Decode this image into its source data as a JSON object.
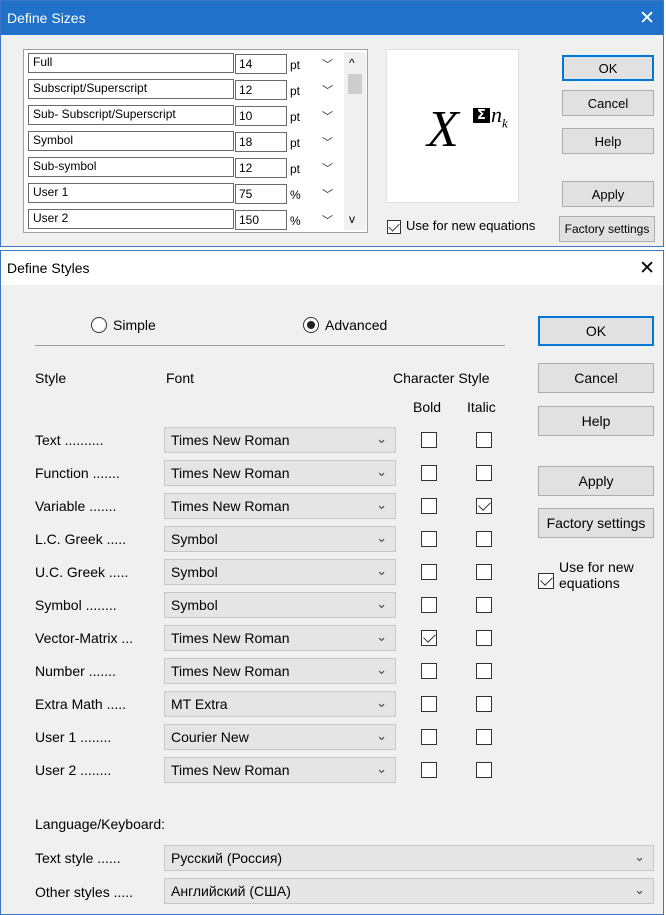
{
  "define_sizes": {
    "title": "Define Sizes",
    "rows": [
      {
        "label": "Full",
        "value": "14",
        "unit": "pt"
      },
      {
        "label": "Subscript/Superscript",
        "value": "12",
        "unit": "pt"
      },
      {
        "label": "Sub- Subscript/Superscript",
        "value": "10",
        "unit": "pt"
      },
      {
        "label": "Symbol",
        "value": "18",
        "unit": "pt"
      },
      {
        "label": "Sub-symbol",
        "value": "12",
        "unit": "pt"
      },
      {
        "label": "User 1",
        "value": "75",
        "unit": "%"
      },
      {
        "label": "User 2",
        "value": "150",
        "unit": "%"
      }
    ],
    "use_for_new_label": "Use for new equations",
    "use_for_new_checked": true,
    "buttons": {
      "ok": "OK",
      "cancel": "Cancel",
      "help": "Help",
      "apply": "Apply",
      "factory": "Factory settings"
    }
  },
  "define_styles": {
    "title": "Define Styles",
    "mode_simple": "Simple",
    "mode_advanced": "Advanced",
    "selected_mode": "Advanced",
    "headers": {
      "style": "Style",
      "font": "Font",
      "char_style": "Character Style",
      "bold": "Bold",
      "italic": "Italic"
    },
    "rows": [
      {
        "label": "Text ..........",
        "font": "Times New Roman",
        "bold": false,
        "italic": false
      },
      {
        "label": "Function .......",
        "font": "Times New Roman",
        "bold": false,
        "italic": false
      },
      {
        "label": "Variable .......",
        "font": "Times New Roman",
        "bold": false,
        "italic": true
      },
      {
        "label": "L.C. Greek .....",
        "font": "Symbol",
        "bold": false,
        "italic": false
      },
      {
        "label": "U.C. Greek .....",
        "font": "Symbol",
        "bold": false,
        "italic": false
      },
      {
        "label": "Symbol ........",
        "font": "Symbol",
        "bold": false,
        "italic": false
      },
      {
        "label": "Vector-Matrix ...",
        "font": "Times New Roman",
        "bold": true,
        "italic": false
      },
      {
        "label": "Number .......",
        "font": "Times New Roman",
        "bold": false,
        "italic": false
      },
      {
        "label": "Extra Math .....",
        "font": "MT Extra",
        "bold": false,
        "italic": false
      },
      {
        "label": "User 1 ........",
        "font": "Courier New",
        "bold": false,
        "italic": false
      },
      {
        "label": "User 2 ........",
        "font": "Times New Roman",
        "bold": false,
        "italic": false
      }
    ],
    "language_label": "Language/Keyboard:",
    "text_style_label": "Text style ......",
    "text_style_value": "Русский (Россия)",
    "other_styles_label": "Other styles .....",
    "other_styles_value": "Английский (США)",
    "use_for_new_label": "Use for new equations",
    "use_for_new_checked": true,
    "buttons": {
      "ok": "OK",
      "cancel": "Cancel",
      "help": "Help",
      "apply": "Apply",
      "factory": "Factory settings"
    }
  }
}
